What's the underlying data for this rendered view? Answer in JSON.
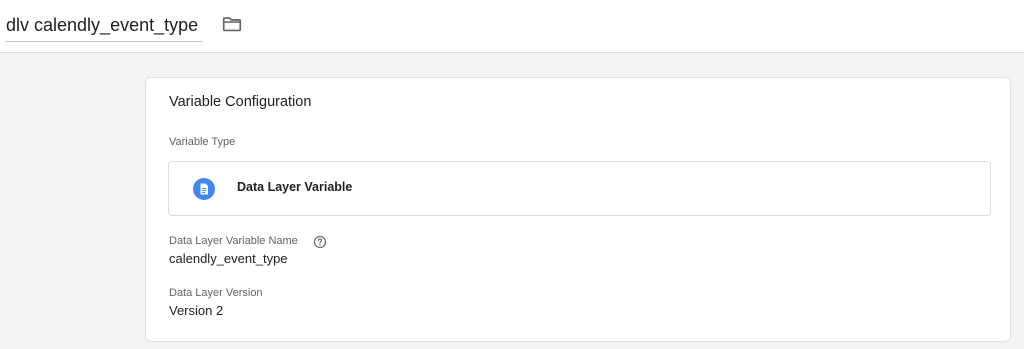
{
  "header": {
    "title": "dlv calendly_event_type",
    "folder_icon": "folder-icon"
  },
  "config": {
    "section_title": "Variable Configuration",
    "variable_type_label": "Variable Type",
    "variable_type": {
      "icon": "document-icon",
      "icon_color": "#4285f4",
      "name": "Data Layer Variable"
    },
    "dlv_name_label": "Data Layer Variable Name",
    "help_icon": "help-icon",
    "dlv_name_value": "calendly_event_type",
    "version_label": "Data Layer Version",
    "version_value": "Version 2"
  }
}
